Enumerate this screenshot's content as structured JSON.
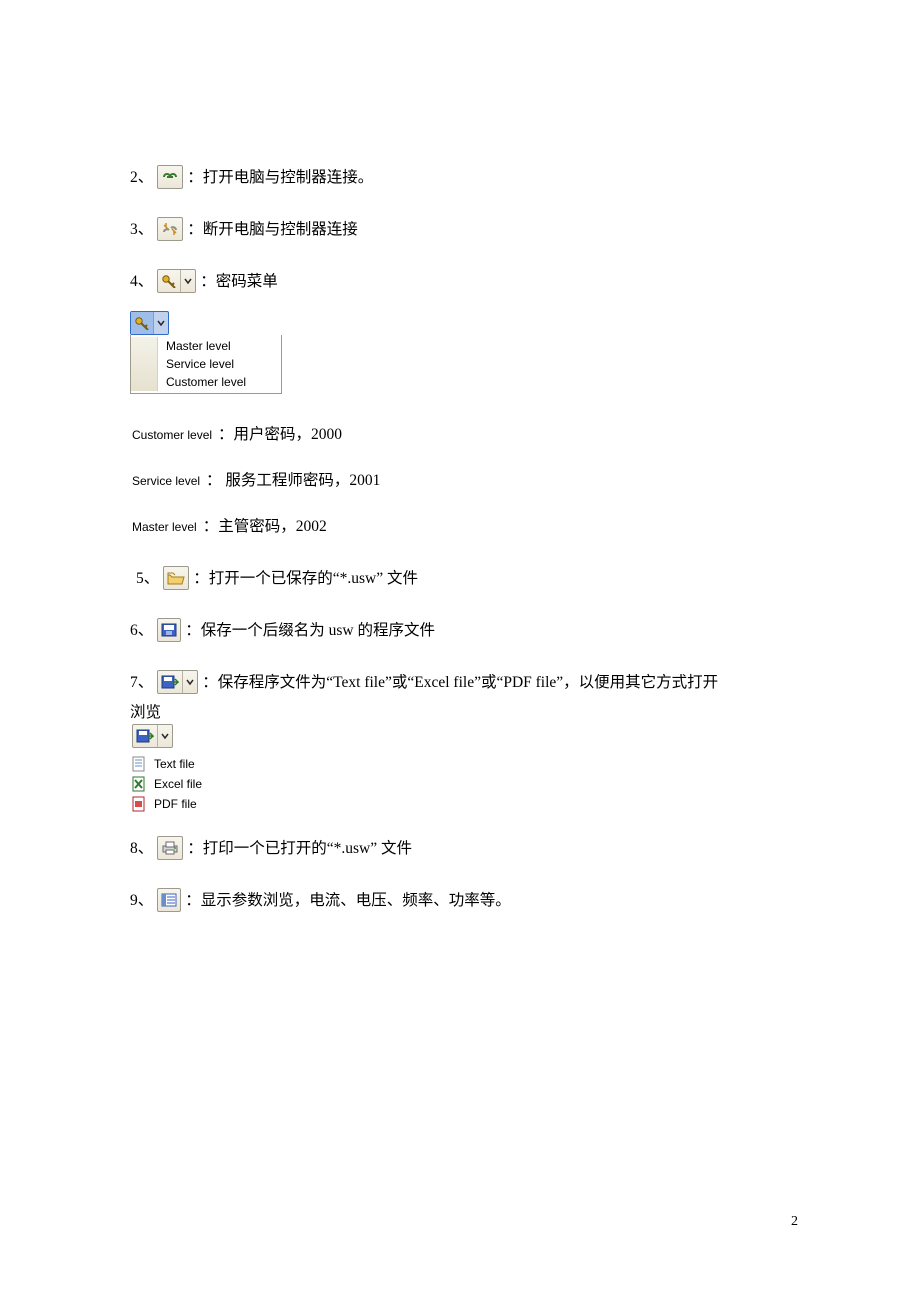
{
  "items": {
    "i2": {
      "num": "2、",
      "text": "：打开电脑与控制器连接。"
    },
    "i3": {
      "num": "3、",
      "text": "：断开电脑与控制器连接"
    },
    "i4": {
      "num": "4、",
      "text": "：密码菜单"
    },
    "i5": {
      "num": "5、",
      "text": "：打开一个已保存的“*.usw” 文件"
    },
    "i6": {
      "num": "6、",
      "text": "：保存一个后缀名为 usw 的程序文件"
    },
    "i7": {
      "num": "7、",
      "text_a": "：保存程序文件为“Text file”或“Excel file”或“PDF file”，以便用其它方式打开",
      "text_b": "浏览"
    },
    "i8": {
      "num": "8、",
      "text": "：打印一个已打开的“*.usw” 文件"
    },
    "i9": {
      "num": "9、",
      "text": "：显示参数浏览，电流、电压、频率、功率等。"
    }
  },
  "menu": {
    "master": "Master level",
    "service": "Service level",
    "customer": "Customer level"
  },
  "pw": {
    "customer": {
      "label": "Customer level",
      "text": "：用户密码，2000"
    },
    "service": {
      "label": "Service level",
      "text": "： 服务工程师密码，2001"
    },
    "master": {
      "label": "Master level",
      "text": "：主管密码，2002"
    }
  },
  "filemenu": {
    "text": "Text file",
    "excel": "Excel file",
    "pdf": "PDF file"
  },
  "page_number": "2"
}
